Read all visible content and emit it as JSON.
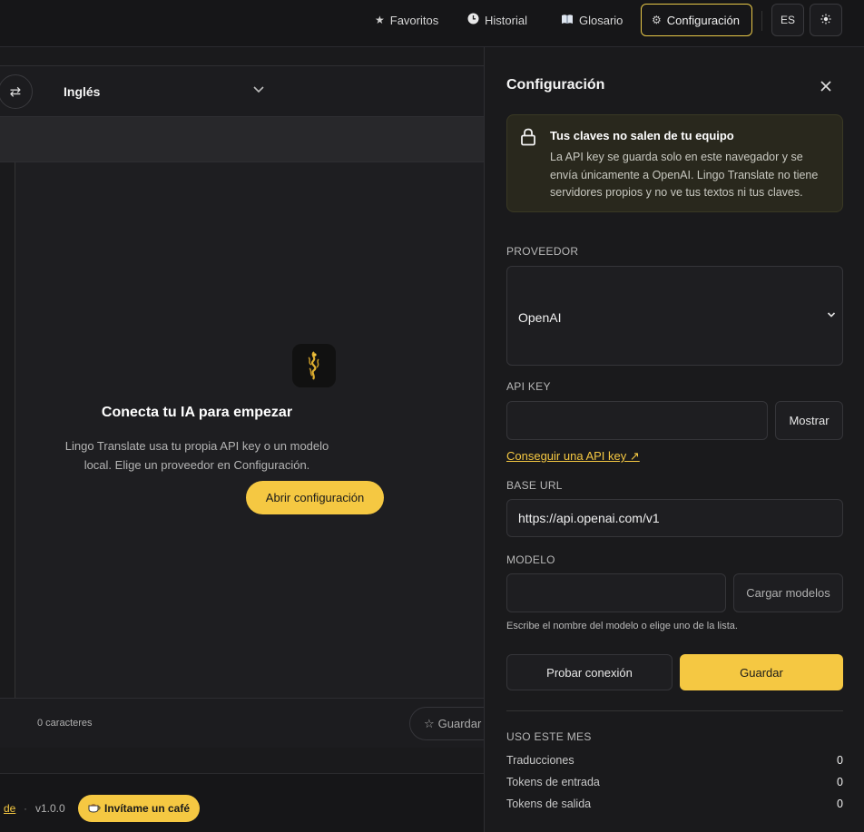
{
  "nav": {
    "favorites": "Favoritos",
    "history": "Historial",
    "glossary": "Glosario",
    "settings": "Configuración",
    "language": "ES"
  },
  "translator": {
    "target_language": "Inglés",
    "empty_title": "Conecta tu IA para empezar",
    "empty_desc_line1": "Lingo Translate usa tu propia API key o un modelo",
    "empty_desc_line2": "local. Elige un proveedor en Configuración.",
    "open_settings": "Abrir configuración",
    "char_count": "0 caracteres",
    "save": "Guardar"
  },
  "footer": {
    "link_fragment": "de",
    "separator": "·",
    "version": "v1.0.0",
    "coffee": "Invítame un café"
  },
  "settings": {
    "title": "Configuración",
    "notice_title": "Tus claves no salen de tu equipo",
    "notice_line1": "La API key se guarda solo en este navegador y se",
    "notice_line2": "envía únicamente a OpenAI. Lingo Translate no tiene",
    "notice_line3": "servidores propios y no ve tus textos ni tus claves.",
    "provider_label": "PROVEEDOR",
    "provider_value": "OpenAI",
    "api_key_label": "API KEY",
    "api_key_value": "",
    "show_button": "Mostrar",
    "get_key_link": "Conseguir una API key ↗",
    "base_url_label": "BASE URL",
    "base_url_value": "https://api.openai.com/v1",
    "model_label": "MODELO",
    "model_value": "",
    "load_models": "Cargar modelos",
    "model_help": "Escribe el nombre del modelo o elige uno de la lista.",
    "test_connection": "Probar conexión",
    "save": "Guardar",
    "usage_title": "USO ESTE MES",
    "usage": [
      {
        "label": "Traducciones",
        "value": "0"
      },
      {
        "label": "Tokens de entrada",
        "value": "0"
      },
      {
        "label": "Tokens de salida",
        "value": "0"
      }
    ]
  },
  "colors": {
    "accent": "#f5c842",
    "background": "#1a1a1c"
  }
}
